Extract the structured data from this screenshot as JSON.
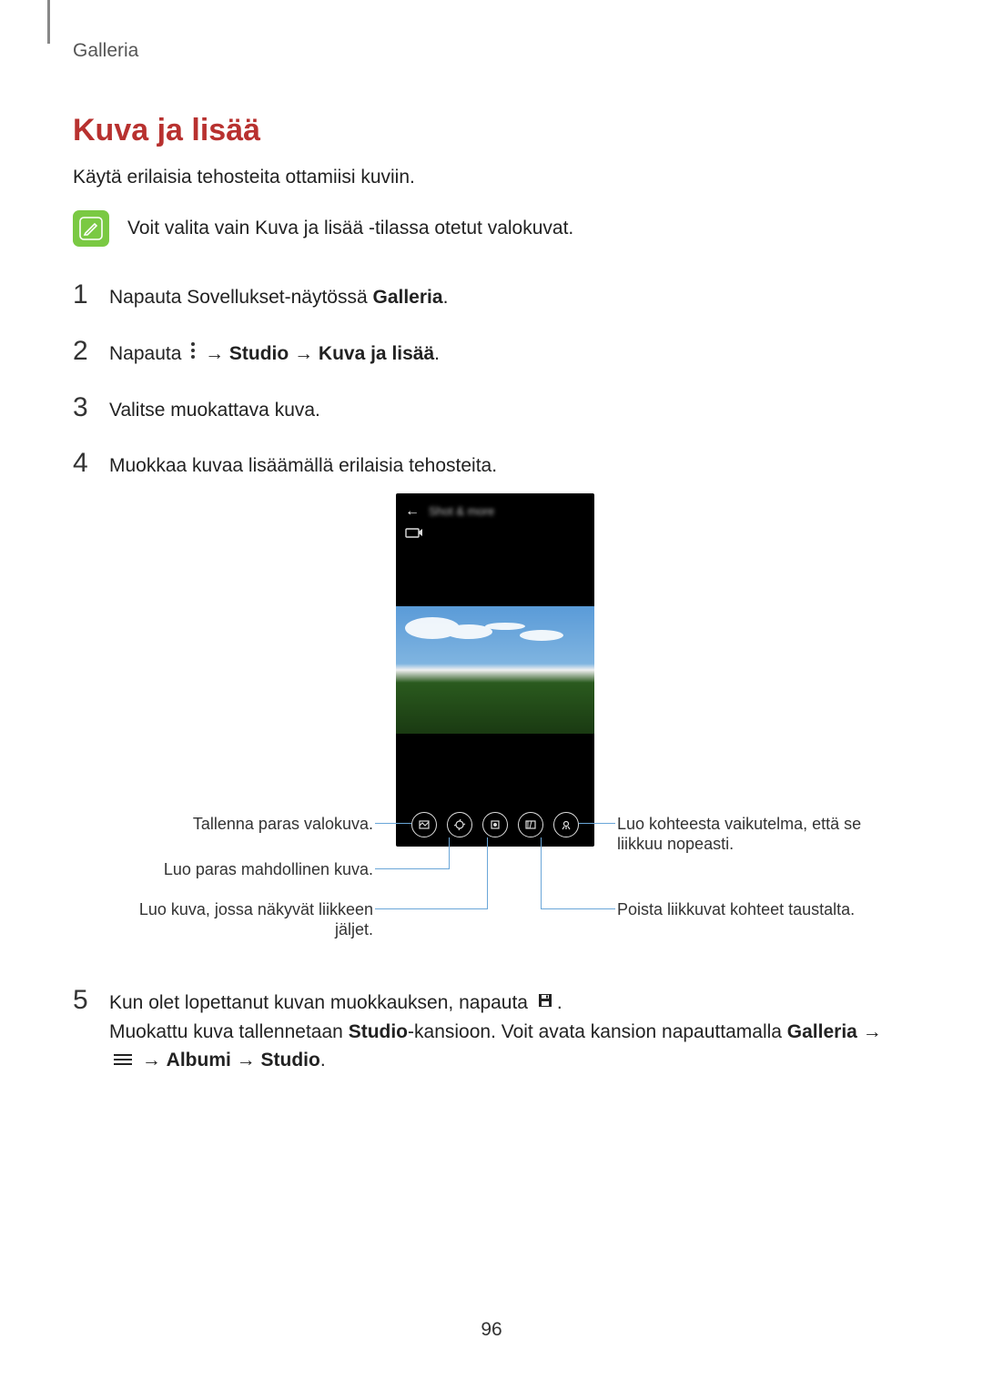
{
  "header": "Galleria",
  "title": "Kuva ja lisää",
  "intro": "Käytä erilaisia tehosteita ottamiisi kuviin.",
  "note": "Voit valita vain Kuva ja lisää -tilassa otetut valokuvat.",
  "steps": {
    "s1_pre": "Napauta Sovellukset-näytössä ",
    "s1_bold": "Galleria",
    "s1_post": ".",
    "s2_pre": "Napauta ",
    "s2_arrow1": " → ",
    "s2_b1": "Studio",
    "s2_arrow2": " → ",
    "s2_b2": "Kuva ja lisää",
    "s2_post": ".",
    "s3": "Valitse muokattava kuva.",
    "s4": "Muokkaa kuvaa lisäämällä erilaisia tehosteita.",
    "s5_pre": "Kun olet lopettanut kuvan muokkauksen, napauta ",
    "s5_post": ".",
    "s5b_pre": "Muokattu kuva tallennetaan ",
    "s5b_b1": "Studio",
    "s5b_mid": "-kansioon. Voit avata kansion napauttamalla ",
    "s5b_b2": "Galleria",
    "s5b_arrow1": " →",
    "s5b_line2_arrow": " → ",
    "s5b_b3": "Albumi",
    "s5b_arrow3": " → ",
    "s5b_b4": "Studio",
    "s5b_end": "."
  },
  "phone": {
    "back_arrow": "←",
    "title_blur": "Shot & more"
  },
  "callouts": {
    "left1": "Tallenna paras valokuva.",
    "left2": "Luo paras mahdollinen kuva.",
    "left3_l1": "Luo kuva, jossa näkyvät liikkeen",
    "left3_l2": "jäljet.",
    "right1_l1": "Luo kohteesta vaikutelma, että se",
    "right1_l2": "liikkuu nopeasti.",
    "right2": "Poista liikkuvat kohteet taustalta."
  },
  "pageNumber": "96"
}
